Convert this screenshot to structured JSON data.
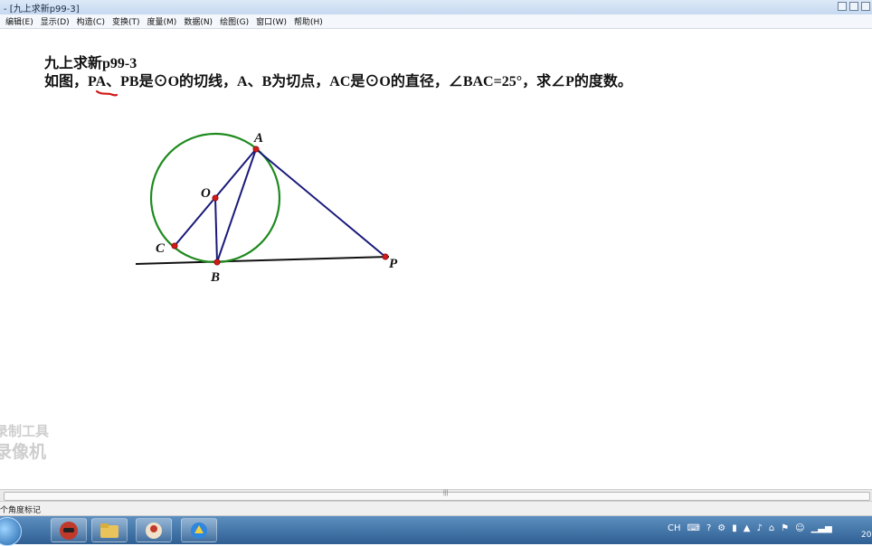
{
  "window": {
    "title": "- [九上求新p99-3]"
  },
  "menu": [
    {
      "label": "编辑(E)"
    },
    {
      "label": "显示(D)"
    },
    {
      "label": "构造(C)"
    },
    {
      "label": "变换(T)"
    },
    {
      "label": "度量(M)"
    },
    {
      "label": "数据(N)"
    },
    {
      "label": "绘图(G)"
    },
    {
      "label": "窗口(W)"
    },
    {
      "label": "帮助(H)"
    }
  ],
  "problem": {
    "title": "九上求新p99-3",
    "text": "如图，PA、PB是⊙O的切线，A、B为切点，AC是⊙O的直径，∠BAC=25°，求∠P的度数。"
  },
  "figure": {
    "points": {
      "A": "A",
      "O": "O",
      "C": "C",
      "B": "B",
      "P": "P"
    },
    "colors": {
      "circle": "#1e8a1e",
      "segments": "#1a1a7a",
      "tangent_line": "#111111",
      "points": "#d11a1a",
      "annotation": "#d11a1a"
    }
  },
  "watermark": {
    "line1": "录制工具",
    "line2": "录像机"
  },
  "statusbar": {
    "text": "个角度标记"
  },
  "taskbar": {
    "apps": [
      "media-app-icon",
      "folder-icon",
      "paint-app-icon",
      "sketchpad-app-icon"
    ],
    "tray_lang": "CH",
    "clock": "20"
  }
}
